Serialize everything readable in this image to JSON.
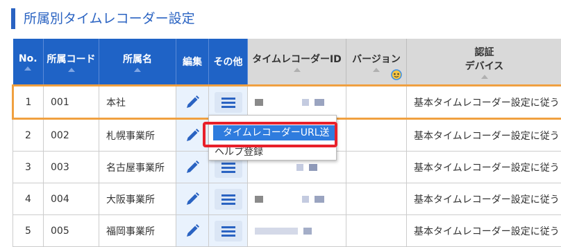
{
  "page_title": "所属別タイムレコーダー設定",
  "columns": {
    "no": "No.",
    "code": "所属コード",
    "name": "所属名",
    "edit": "編集",
    "other": "その他",
    "recorder_id": "タイムレコーダーID",
    "version": "バージョン",
    "auth_line1": "認証",
    "auth_line2": "デバイス"
  },
  "rows": [
    {
      "no": "1",
      "code": "001",
      "name": "本社",
      "auth": "基本タイムレコーダー設定に従う"
    },
    {
      "no": "2",
      "code": "002",
      "name": "札幌事業所",
      "auth": "基本タイムレコーダー設定に従う"
    },
    {
      "no": "3",
      "code": "003",
      "name": "名古屋事業所",
      "auth": "基本タイムレコーダー設定に従う"
    },
    {
      "no": "4",
      "code": "004",
      "name": "大阪事業所",
      "auth": "基本タイムレコーダー設定に従う"
    },
    {
      "no": "5",
      "code": "005",
      "name": "福岡事業所",
      "auth": "基本タイムレコーダー設定に従う"
    }
  ],
  "dropdown": {
    "item_send_url": "タイムレコーダーURL送信",
    "item_help": "ヘルプ登録"
  },
  "colors": {
    "header_blue": "#1f63c6",
    "accent_blue": "#2a63c2",
    "selected_row": "#f0a040",
    "highlight_red": "#e8202a"
  },
  "icons": [
    "pencil-icon",
    "menu-icon",
    "face-icon",
    "sort-arrow-icon"
  ]
}
